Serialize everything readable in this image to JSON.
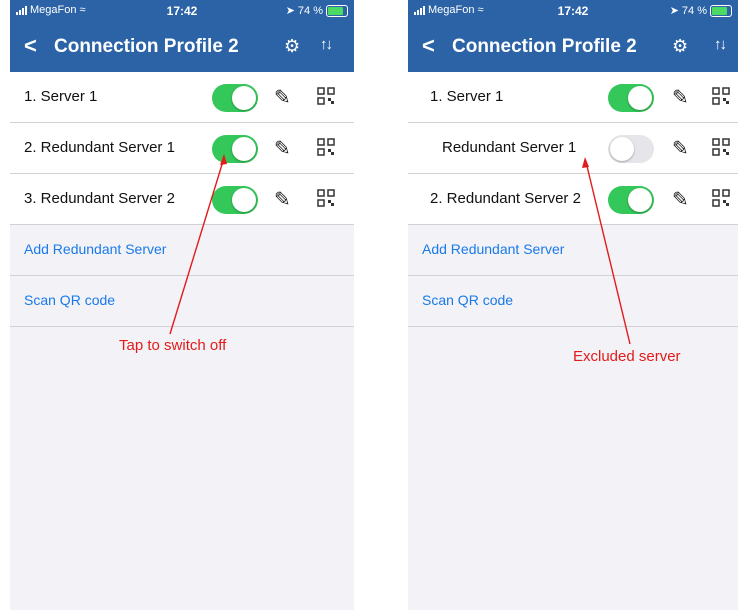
{
  "left": {
    "status": {
      "carrier": "MegaFon",
      "time": "17:42",
      "battery": "74 %"
    },
    "nav": {
      "back": "<",
      "title": "Connection Profile 2",
      "settings_icon": "gear-icon",
      "sort_icon": "sort-icon"
    },
    "servers": [
      {
        "label": "1. Server 1",
        "enabled": true
      },
      {
        "label": "2. Redundant Server 1",
        "enabled": true
      },
      {
        "label": "3. Redundant Server 2",
        "enabled": true
      }
    ],
    "actions": {
      "add": "Add Redundant Server",
      "scan": "Scan QR code"
    },
    "annotation": "Tap to switch off"
  },
  "right": {
    "status": {
      "carrier": "MegaFon",
      "time": "17:42",
      "battery": "74 %"
    },
    "nav": {
      "back": "<",
      "title": "Connection Profile 2",
      "settings_icon": "gear-icon",
      "sort_icon": "sort-icon"
    },
    "servers": [
      {
        "label": "1. Server 1",
        "enabled": true
      },
      {
        "label": "Redundant Server 1",
        "enabled": false
      },
      {
        "label": "2. Redundant Server 2",
        "enabled": true
      }
    ],
    "actions": {
      "add": "Add Redundant Server",
      "scan": "Scan QR code"
    },
    "annotation": "Excluded server"
  },
  "colors": {
    "header": "#2b63a6",
    "toggle_on": "#34c759",
    "toggle_off": "#e5e5ea",
    "link": "#1a7ae8",
    "annotation": "#e31b1b"
  }
}
